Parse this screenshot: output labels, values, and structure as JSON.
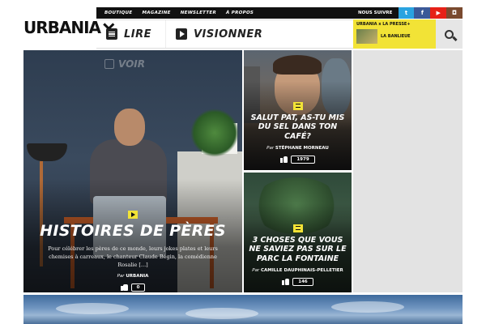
{
  "brand": {
    "logo": "URBANIA"
  },
  "top_links": [
    "BOUTIQUE",
    "MAGAZINE",
    "NEWSLETTER",
    "À PROPOS"
  ],
  "follow": {
    "label": "NOUS SUIVRE",
    "networks": [
      "twitter-icon",
      "facebook-icon",
      "youtube-icon",
      "instagram-icon"
    ]
  },
  "nav": {
    "read": "LIRE",
    "watch": "VISIONNER"
  },
  "presse": {
    "title": "URBANIA x LA PRESSE+",
    "item": "LA BANLIEUE"
  },
  "hero": {
    "section_label": "VOIR",
    "title": "HISTOIRES DE PÈRES",
    "description": "Pour célébrer les pères de ce monde, leurs jokes plates et leurs chemises à carreaux, le chanteur Claude Bégin, la comédienne Rosalie [...]",
    "by": "Par",
    "author": "URBANIA",
    "likes": "0"
  },
  "cards": [
    {
      "title": "SALUT PAT, AS-TU MIS DU SEL DANS TON CAFÉ?",
      "by": "Par",
      "author": "STÉPHANE MORNEAU",
      "likes": "1979"
    },
    {
      "title": "3 CHOSES QUE VOUS NE SAVIEZ PAS SUR LE PARC LA FONTAINE",
      "by": "Par",
      "author": "CAMILLE DAUPHINAIS-PELLETIER",
      "likes": "146"
    }
  ],
  "colors": {
    "accent_yellow": "#f2e336",
    "dark": "#111111",
    "twitter": "#2aa3e0",
    "facebook": "#3b5998",
    "youtube": "#e62117",
    "instagram": "#7a4a2f"
  }
}
